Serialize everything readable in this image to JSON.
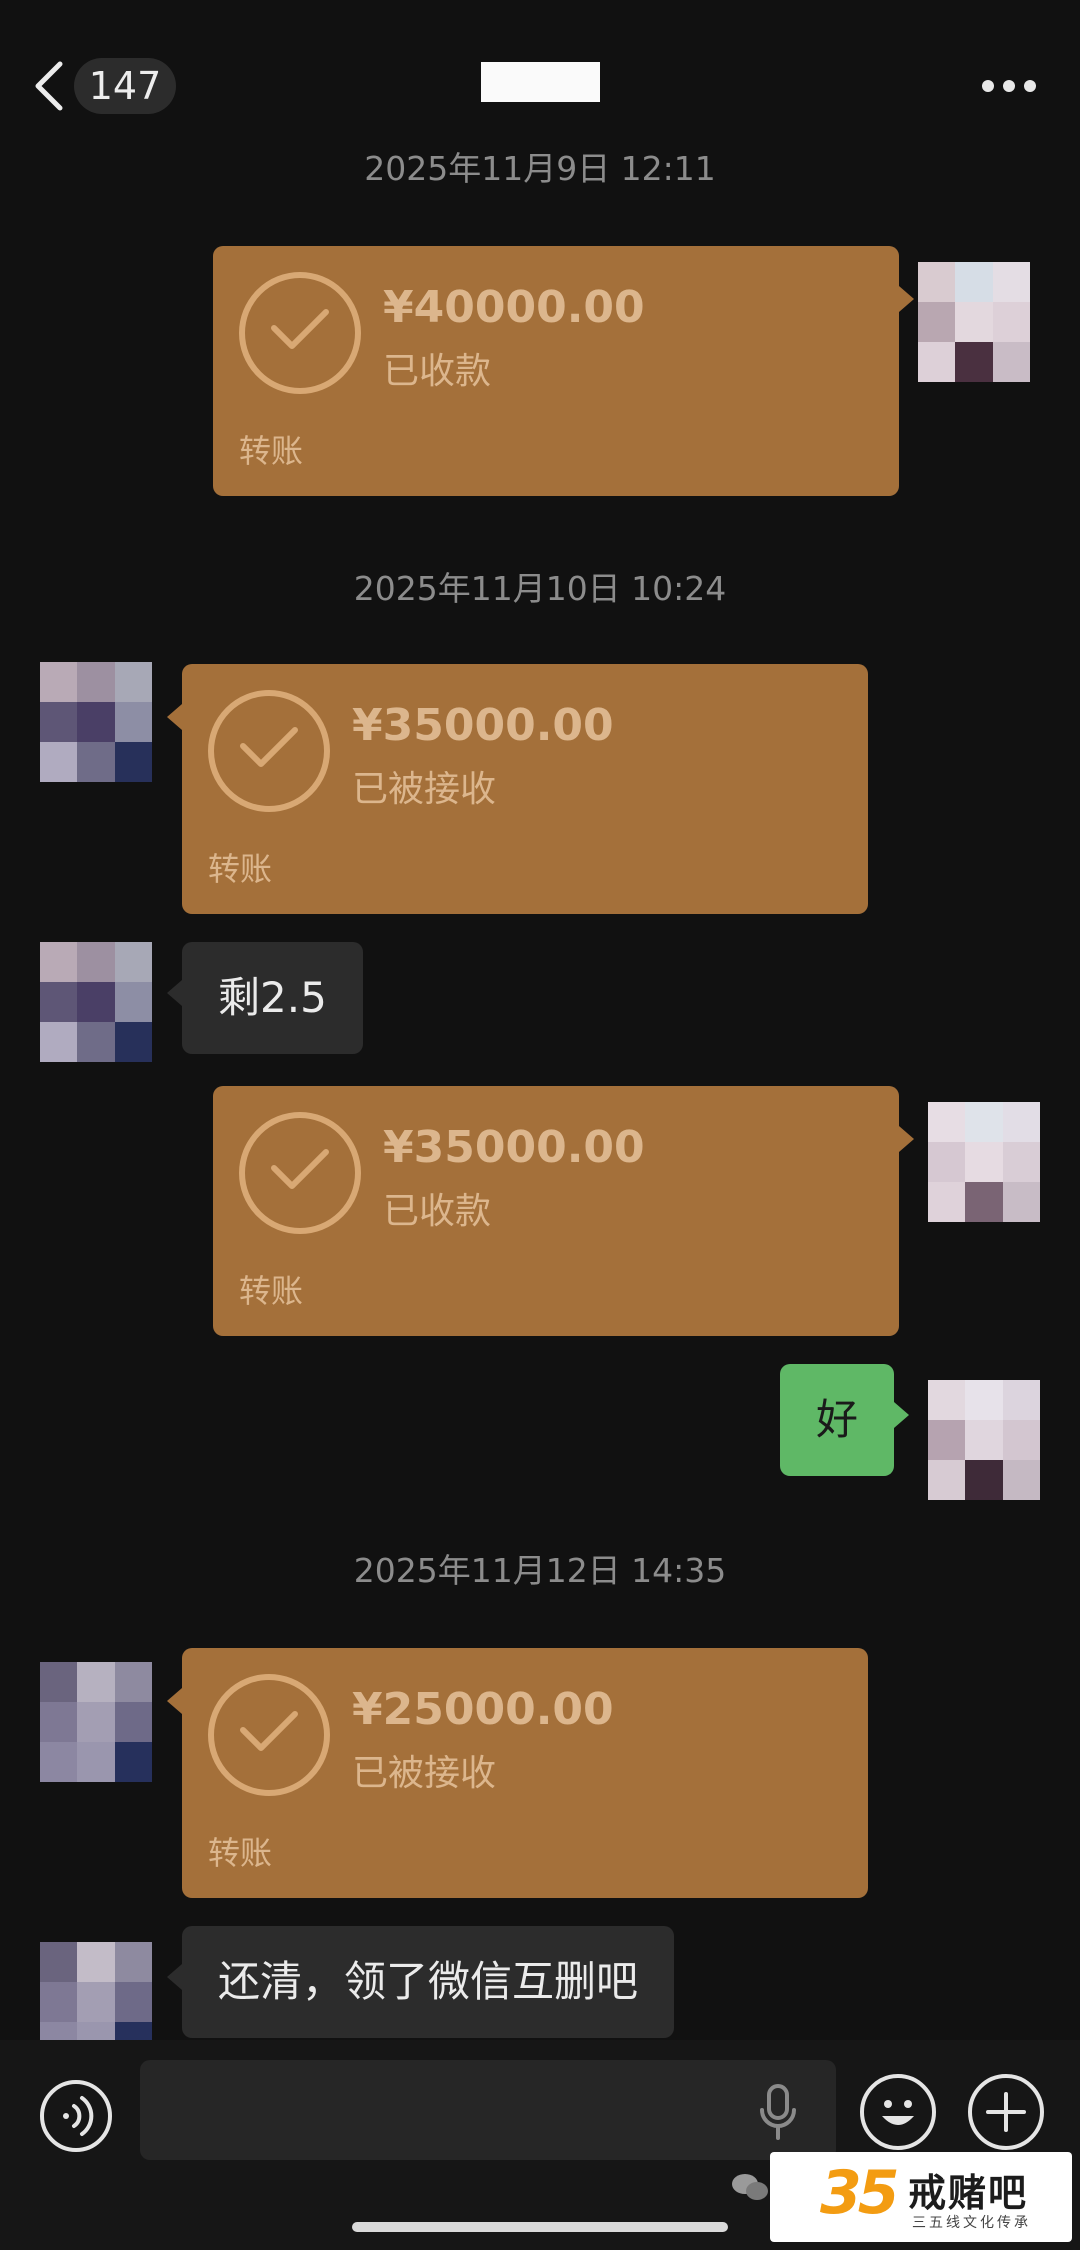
{
  "header": {
    "unread_count": "147"
  },
  "timestamps": [
    "2025年11月9日 12:11",
    "2025年11月10日 10:24",
    "2025年11月12日 14:35"
  ],
  "messages": [
    {
      "type": "transfer",
      "from": "me",
      "amount": "¥40000.00",
      "status": "已收款",
      "label": "转账"
    },
    {
      "type": "transfer",
      "from": "them",
      "amount": "¥35000.00",
      "status": "已被接收",
      "label": "转账"
    },
    {
      "type": "text",
      "from": "them",
      "text": "剩2.5"
    },
    {
      "type": "transfer",
      "from": "me",
      "amount": "¥35000.00",
      "status": "已收款",
      "label": "转账"
    },
    {
      "type": "text",
      "from": "me",
      "text": "好"
    },
    {
      "type": "transfer",
      "from": "them",
      "amount": "¥25000.00",
      "status": "已被接收",
      "label": "转账"
    },
    {
      "type": "text",
      "from": "them",
      "text": "还清，领了微信互删吧"
    }
  ],
  "watermark": {
    "number": "35",
    "brand": "戒赌吧",
    "subtitle": "三五线文化传承"
  },
  "colors": {
    "background": "#111111",
    "transfer_card": "#a4703a",
    "my_bubble": "#5fb866",
    "their_bubble": "#2c2c2c"
  },
  "icons": [
    "back-chevron-icon",
    "more-dots-icon",
    "check-icon",
    "voice-icon",
    "microphone-icon",
    "emoji-icon",
    "plus-icon",
    "wechat-icon"
  ]
}
